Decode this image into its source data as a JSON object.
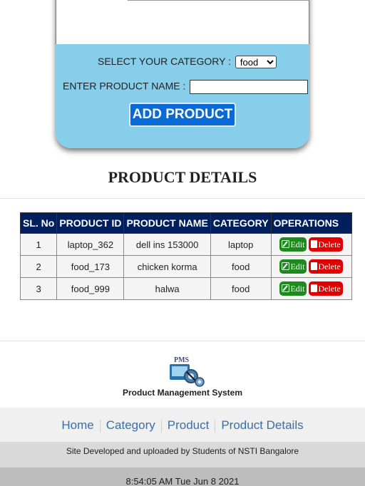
{
  "form": {
    "category_label": "SELECT YOUR CATEGORY :",
    "category_selected": "food",
    "product_name_label": "ENTER PRODUCT NAME :",
    "product_name_value": "",
    "add_button_label": "ADD PRODUCT"
  },
  "details": {
    "title": "PRODUCT DETAILS",
    "headers": {
      "sl_no": "SL. No",
      "product_id": "PRODUCT ID",
      "product_name": "PRODUCT NAME",
      "category": "CATEGORY",
      "operations": "OPERATIONS"
    },
    "rows": [
      {
        "sl": "1",
        "id": "laptop_362",
        "name": "dell ins 153000",
        "category": "laptop"
      },
      {
        "sl": "2",
        "id": "food_173",
        "name": "chicken korma",
        "category": "food"
      },
      {
        "sl": "3",
        "id": "food_999",
        "name": "halwa",
        "category": "food"
      }
    ],
    "edit_label": "Edit",
    "delete_label": "Delete"
  },
  "footer": {
    "logo_text": "PMS",
    "brand_name": "Product Management System",
    "nav": [
      "Home",
      "Category",
      "Product",
      "Product Details"
    ],
    "credit": "Site Developed and uploaded by Students of NSTI Bangalore",
    "clock": "8:54:05 AM  Tue   Jun 8  2021"
  },
  "colors": {
    "form_bg": "#87ceeb",
    "button_bg": "#0a6ad3",
    "table_header_bg": "#001f5c",
    "edit_bg": "#1e8a1e",
    "delete_bg": "#e00000",
    "nav_link": "#3b6ea8"
  },
  "icons": [
    "cart-illustration",
    "edit-icon",
    "trash-icon",
    "pms-gear-logo"
  ]
}
